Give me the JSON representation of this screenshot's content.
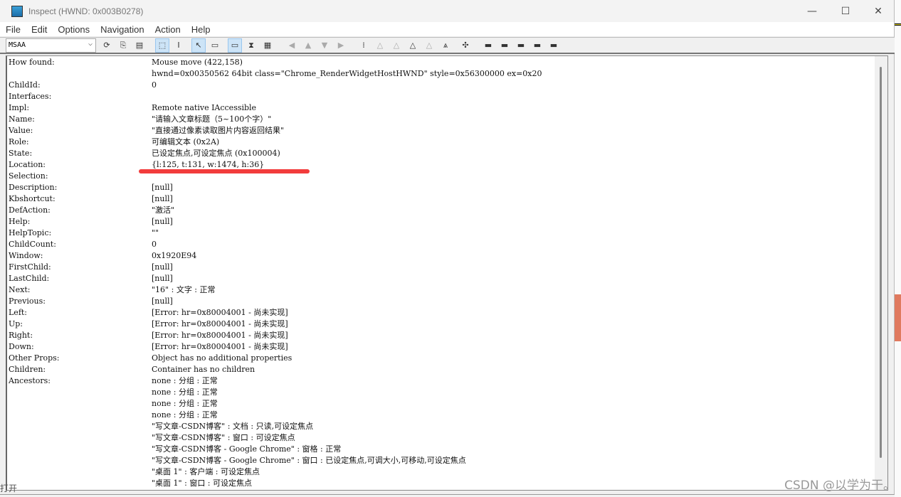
{
  "window": {
    "title": "Inspect  (HWND: 0x003B0278)",
    "minimize": "—",
    "maximize": "☐",
    "close": "✕"
  },
  "menu": [
    "File",
    "Edit",
    "Options",
    "Navigation",
    "Action",
    "Help"
  ],
  "toolbar": {
    "mode": "MSAA",
    "buttons": [
      {
        "icon": "refresh-icon",
        "glyph": "⟳"
      },
      {
        "icon": "copy-icon",
        "glyph": "⎘"
      },
      {
        "icon": "properties-icon",
        "glyph": "▤"
      },
      {
        "icon": "watch-focus-icon",
        "glyph": "⬚",
        "selected": true
      },
      {
        "icon": "watch-caret-icon",
        "glyph": "I"
      },
      {
        "icon": "watch-cursor-icon",
        "glyph": "↖",
        "selected": true
      },
      {
        "icon": "tooltip-icon",
        "glyph": "▭"
      },
      {
        "icon": "highlight-rect-icon",
        "glyph": "▭",
        "selected": true
      },
      {
        "icon": "hourglass-icon",
        "glyph": "⧗"
      },
      {
        "icon": "caret-highlight-icon",
        "glyph": "▦"
      },
      {
        "icon": "back-icon",
        "glyph": "◀",
        "disabled": true
      },
      {
        "icon": "up-icon",
        "glyph": "▲",
        "disabled": true
      },
      {
        "icon": "down-icon",
        "glyph": "▼",
        "disabled": true
      },
      {
        "icon": "forward-icon",
        "glyph": "▶",
        "disabled": true
      },
      {
        "icon": "parent-icon",
        "glyph": "⁞"
      },
      {
        "icon": "first-child-icon",
        "glyph": "△",
        "disabled": true
      },
      {
        "icon": "prev-sibling-icon",
        "glyph": "△",
        "disabled": true
      },
      {
        "icon": "next-sibling-icon",
        "glyph": "△"
      },
      {
        "icon": "last-child-icon",
        "glyph": "△",
        "disabled": true
      },
      {
        "icon": "children-icon",
        "glyph": "⩓"
      },
      {
        "icon": "hit-test-icon",
        "glyph": "✣"
      },
      {
        "icon": "default-action-icon",
        "glyph": "▬"
      },
      {
        "icon": "select-icon",
        "glyph": "▬"
      },
      {
        "icon": "take-focus-icon",
        "glyph": "▬"
      },
      {
        "icon": "add-selection-icon",
        "glyph": "▬"
      },
      {
        "icon": "remove-selection-icon",
        "glyph": "▬"
      }
    ]
  },
  "properties": [
    {
      "label": "How found:",
      "value": "Mouse move (422,158)"
    },
    {
      "label": "",
      "value": "hwnd=0x00350562 64bit class=\"Chrome_RenderWidgetHostHWND\" style=0x56300000 ex=0x20"
    },
    {
      "label": "ChildId:",
      "value": "0"
    },
    {
      "label": "Interfaces:",
      "value": ""
    },
    {
      "label": "Impl:",
      "value": "Remote native IAccessible"
    },
    {
      "label": "Name:",
      "value": "\"请输入文章标题（5~100个字）\""
    },
    {
      "label": "Value:",
      "value": "\"直接通过像素读取图片内容返回结果\""
    },
    {
      "label": "Role:",
      "value": "可编辑文本 (0x2A)"
    },
    {
      "label": "State:",
      "value": "已设定焦点,可设定焦点 (0x100004)"
    },
    {
      "label": "Location:",
      "value": "{l:125, t:131, w:1474, h:36}"
    },
    {
      "label": "Selection:",
      "value": ""
    },
    {
      "label": "Description:",
      "value": "[null]"
    },
    {
      "label": "Kbshortcut:",
      "value": "[null]"
    },
    {
      "label": "DefAction:",
      "value": "\"激活\""
    },
    {
      "label": "Help:",
      "value": "[null]"
    },
    {
      "label": "HelpTopic:",
      "value": "\"\""
    },
    {
      "label": "ChildCount:",
      "value": "0"
    },
    {
      "label": "Window:",
      "value": "0x1920E94"
    },
    {
      "label": "FirstChild:",
      "value": "[null]"
    },
    {
      "label": "LastChild:",
      "value": "[null]"
    },
    {
      "label": "Next:",
      "value": "\"16\" : 文字 : 正常"
    },
    {
      "label": "Previous:",
      "value": "[null]"
    },
    {
      "label": "Left:",
      "value": "[Error: hr=0x80004001 - 尚未实现]"
    },
    {
      "label": "Up:",
      "value": "[Error: hr=0x80004001 - 尚未实现]"
    },
    {
      "label": "Right:",
      "value": "[Error: hr=0x80004001 - 尚未实现]"
    },
    {
      "label": "Down:",
      "value": "[Error: hr=0x80004001 - 尚未实现]"
    },
    {
      "label": "Other Props:",
      "value": "Object has no additional properties"
    },
    {
      "label": "Children:",
      "value": "Container has no children"
    },
    {
      "label": "Ancestors:",
      "value": "none : 分组 : 正常"
    },
    {
      "label": "",
      "value": "none : 分组 : 正常"
    },
    {
      "label": "",
      "value": "none : 分组 : 正常"
    },
    {
      "label": "",
      "value": "none : 分组 : 正常"
    },
    {
      "label": "",
      "value": "\"写文章-CSDN博客\" : 文档 : 只读,可设定焦点"
    },
    {
      "label": "",
      "value": "\"写文章-CSDN博客\" : 窗口 : 可设定焦点"
    },
    {
      "label": "",
      "value": "\"写文章-CSDN博客 - Google Chrome\" : 窗格 : 正常"
    },
    {
      "label": "",
      "value": "\"写文章-CSDN博客 - Google Chrome\" : 窗口 : 已设定焦点,可调大小,可移动,可设定焦点"
    },
    {
      "label": "",
      "value": "\"桌面 1\" : 客户端 : 可设定焦点"
    },
    {
      "label": "",
      "value": "\"桌面 1\" : 窗口 : 可设定焦点"
    }
  ],
  "annotation_color": "#f23c3c",
  "watermark": "CSDN @以学为干。",
  "background_fragment": "打开"
}
